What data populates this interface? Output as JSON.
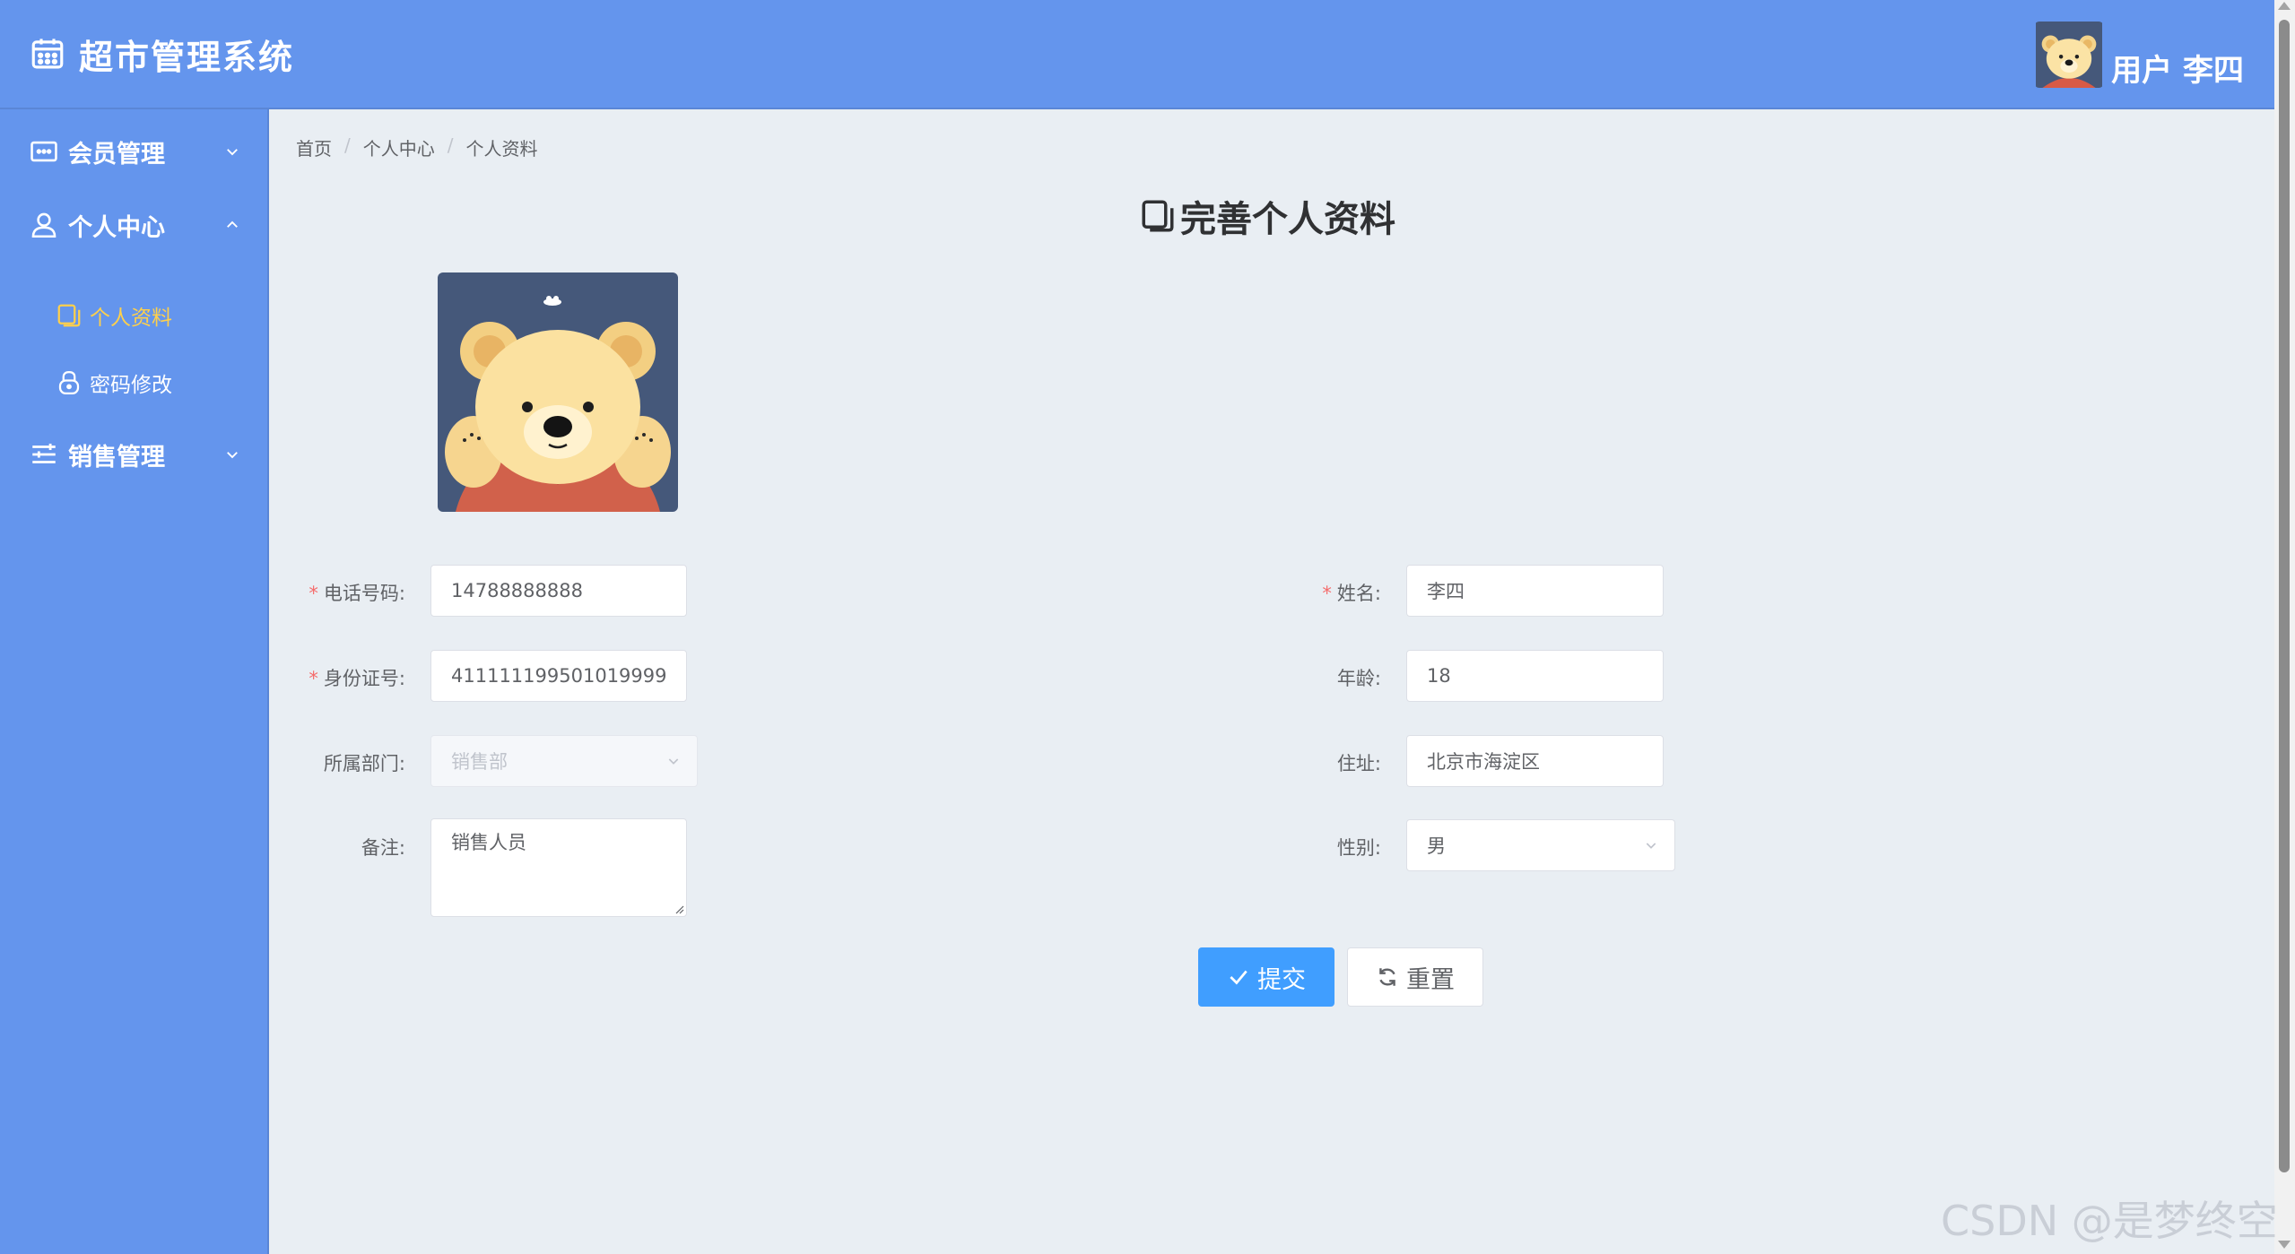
{
  "header": {
    "app_title": "超市管理系统",
    "user_label": "用户 李四"
  },
  "sidebar": {
    "items": [
      {
        "label": "会员管理",
        "icon": "id-card-icon",
        "expanded": false
      },
      {
        "label": "个人中心",
        "icon": "user-icon",
        "expanded": true
      },
      {
        "label": "销售管理",
        "icon": "menu-list-icon",
        "expanded": false
      }
    ],
    "sub_items": [
      {
        "label": "个人资料",
        "icon": "document-copy-icon",
        "active": true
      },
      {
        "label": "密码修改",
        "icon": "lock-icon",
        "active": false
      }
    ]
  },
  "breadcrumb": [
    "首页",
    "个人中心",
    "个人资料"
  ],
  "page_title": "完善个人资料",
  "form": {
    "phone": {
      "label": "电话号码:",
      "value": "14788888888",
      "required": true
    },
    "name": {
      "label": "姓名:",
      "value": "李四",
      "required": true
    },
    "id_number": {
      "label": "身份证号:",
      "value": "411111199501019999",
      "required": true
    },
    "age": {
      "label": "年龄:",
      "value": "18"
    },
    "department": {
      "label": "所属部门:",
      "value": "销售部",
      "disabled": true
    },
    "address": {
      "label": "住址:",
      "value": "北京市海淀区"
    },
    "remark": {
      "label": "备注:",
      "value": "销售人员"
    },
    "gender": {
      "label": "性别:",
      "value": "男"
    }
  },
  "buttons": {
    "submit": "提交",
    "reset": "重置"
  },
  "watermark": "CSDN @是梦终空",
  "colors": {
    "header_bg": "#6495ed",
    "sidebar_bg": "#6495ed",
    "active_menu": "#ffd04b",
    "primary": "#409eff",
    "page_bg": "#e9eef3"
  }
}
